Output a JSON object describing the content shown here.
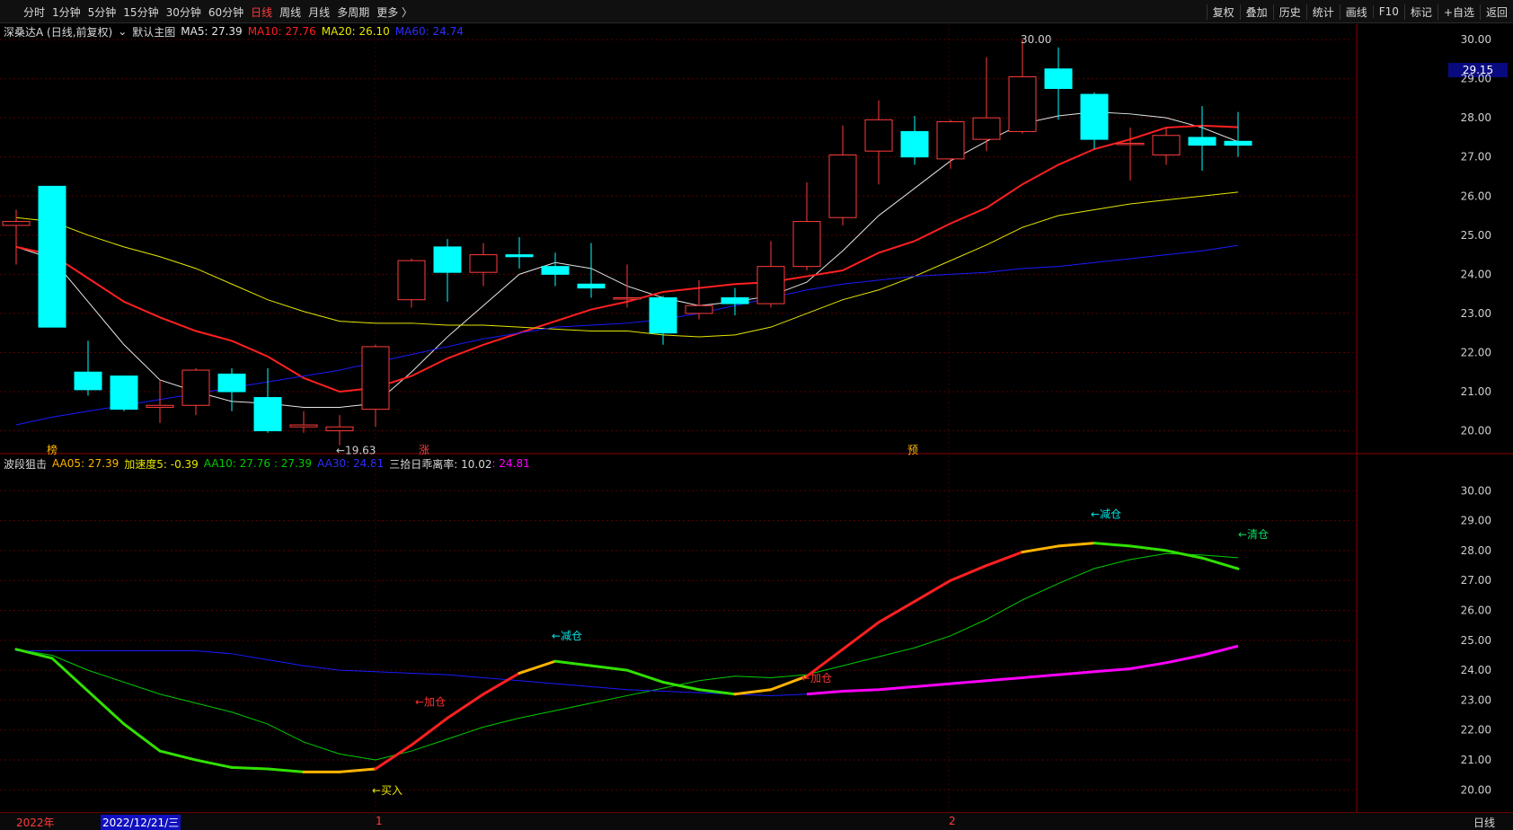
{
  "toolbar": {
    "periods": [
      "分时",
      "1分钟",
      "5分钟",
      "15分钟",
      "30分钟",
      "60分钟",
      "日线",
      "周线",
      "月线",
      "多周期",
      "更多 〉"
    ],
    "active_period": "日线",
    "tools": [
      "复权",
      "叠加",
      "历史",
      "统计",
      "画线",
      "F10",
      "标记",
      "+自选",
      "返回"
    ]
  },
  "main_legend": {
    "stock": "深桑达A (日线,前复权)",
    "template": "默认主图",
    "ma5": "MA5: 27.39",
    "ma10": "MA10: 27.76",
    "ma20": "MA20: 26.10",
    "ma60": "MA60: 24.74"
  },
  "sub_legend": {
    "name": "波段狙击",
    "aa05": "AA05: 27.39",
    "accel": "加速度5: -0.39",
    "aa10": "AA10: 27.76 : 27.39",
    "aa30": "AA30: 24.81",
    "deviation_label": "三拾日乖离率: 10.02",
    "deviation_value": ": 24.81"
  },
  "current_price": "29.15",
  "high_marker": "30.00",
  "low_marker": "←19.63",
  "event_markers": [
    "榜",
    "涨",
    "预"
  ],
  "signals": {
    "buy": "←买入",
    "add1": "←加仓",
    "reduce1": "←减仓",
    "add2": "←加仓",
    "reduce2": "←减仓",
    "clear": "←清仓"
  },
  "bottom_bar": {
    "year": "2022年",
    "date": "2022/12/21/三",
    "month1": "1",
    "month2": "2",
    "period": "日线"
  },
  "colors": {
    "up": "#ff3c3c",
    "down": "#00ffff",
    "ma5": "#e6e6e6",
    "ma10": "#ff2020",
    "ma20": "#e6e600",
    "ma60": "#1a1aff",
    "aa10": "#00cc00",
    "deviation": "#ff00ff"
  },
  "chart_data": [
    {
      "type": "candlestick",
      "title": "深桑达A (日线,前复权)",
      "ylim": [
        19.6,
        30.3
      ],
      "y_ticks": [
        20,
        21,
        22,
        23,
        24,
        25,
        26,
        27,
        28,
        29,
        30
      ],
      "candles": [
        {
          "o": 25.25,
          "h": 25.65,
          "l": 24.25,
          "c": 25.35
        },
        {
          "o": 26.25,
          "h": 26.25,
          "l": 22.65,
          "c": 22.65
        },
        {
          "o": 21.5,
          "h": 22.3,
          "l": 20.9,
          "c": 21.05
        },
        {
          "o": 21.4,
          "h": 21.4,
          "l": 20.5,
          "c": 20.55
        },
        {
          "o": 20.6,
          "h": 21.3,
          "l": 20.2,
          "c": 20.65
        },
        {
          "o": 20.65,
          "h": 21.6,
          "l": 20.4,
          "c": 21.55
        },
        {
          "o": 21.45,
          "h": 21.6,
          "l": 20.5,
          "c": 21.0
        },
        {
          "o": 20.85,
          "h": 21.6,
          "l": 19.95,
          "c": 20.0
        },
        {
          "o": 20.1,
          "h": 20.5,
          "l": 19.95,
          "c": 20.15
        },
        {
          "o": 20.0,
          "h": 20.4,
          "l": 19.63,
          "c": 20.1
        },
        {
          "o": 20.55,
          "h": 22.2,
          "l": 20.1,
          "c": 22.15
        },
        {
          "o": 23.35,
          "h": 24.4,
          "l": 23.15,
          "c": 24.35
        },
        {
          "o": 24.7,
          "h": 24.9,
          "l": 23.3,
          "c": 24.05
        },
        {
          "o": 24.05,
          "h": 24.8,
          "l": 23.7,
          "c": 24.5
        },
        {
          "o": 24.5,
          "h": 24.95,
          "l": 24.15,
          "c": 24.45
        },
        {
          "o": 24.2,
          "h": 24.55,
          "l": 23.7,
          "c": 24.0
        },
        {
          "o": 23.75,
          "h": 24.8,
          "l": 23.4,
          "c": 23.65
        },
        {
          "o": 23.4,
          "h": 24.25,
          "l": 23.15,
          "c": 23.4
        },
        {
          "o": 23.4,
          "h": 23.45,
          "l": 22.2,
          "c": 22.5
        },
        {
          "o": 23.0,
          "h": 23.85,
          "l": 22.85,
          "c": 23.2
        },
        {
          "o": 23.4,
          "h": 23.65,
          "l": 22.95,
          "c": 23.25
        },
        {
          "o": 23.25,
          "h": 24.85,
          "l": 23.15,
          "c": 24.2
        },
        {
          "o": 24.2,
          "h": 26.35,
          "l": 24.1,
          "c": 25.35
        },
        {
          "o": 25.45,
          "h": 27.8,
          "l": 25.25,
          "c": 27.05
        },
        {
          "o": 27.15,
          "h": 28.45,
          "l": 26.3,
          "c": 27.95
        },
        {
          "o": 27.65,
          "h": 28.05,
          "l": 26.8,
          "c": 27.0
        },
        {
          "o": 26.95,
          "h": 27.95,
          "l": 26.7,
          "c": 27.9
        },
        {
          "o": 27.45,
          "h": 29.55,
          "l": 27.15,
          "c": 28.0
        },
        {
          "o": 27.65,
          "h": 30.0,
          "l": 27.6,
          "c": 29.05
        },
        {
          "o": 29.25,
          "h": 29.8,
          "l": 27.95,
          "c": 28.75
        },
        {
          "o": 28.6,
          "h": 28.65,
          "l": 27.2,
          "c": 27.45
        },
        {
          "o": 27.35,
          "h": 27.75,
          "l": 26.4,
          "c": 27.35
        },
        {
          "o": 27.05,
          "h": 27.75,
          "l": 26.8,
          "c": 27.55
        },
        {
          "o": 27.5,
          "h": 28.3,
          "l": 26.65,
          "c": 27.3
        },
        {
          "o": 27.4,
          "h": 28.15,
          "l": 27.0,
          "c": 27.3
        }
      ],
      "series": [
        {
          "name": "MA5",
          "values": [
            24.7,
            24.4,
            23.3,
            22.2,
            21.3,
            21.0,
            20.75,
            20.7,
            20.6,
            20.6,
            20.7,
            21.5,
            22.4,
            23.2,
            24.0,
            24.3,
            24.15,
            23.7,
            23.4,
            23.2,
            23.3,
            23.45,
            23.8,
            24.6,
            25.5,
            26.2,
            26.9,
            27.4,
            27.85,
            28.05,
            28.15,
            28.1,
            28.0,
            27.75,
            27.39
          ]
        },
        {
          "name": "MA10",
          "values": [
            24.7,
            24.5,
            23.9,
            23.3,
            22.9,
            22.55,
            22.3,
            21.9,
            21.35,
            21.0,
            21.1,
            21.4,
            21.85,
            22.2,
            22.5,
            22.8,
            23.1,
            23.3,
            23.55,
            23.65,
            23.75,
            23.8,
            23.95,
            24.1,
            24.55,
            24.85,
            25.3,
            25.7,
            26.3,
            26.8,
            27.2,
            27.45,
            27.75,
            27.8,
            27.76
          ]
        },
        {
          "name": "MA20",
          "values": [
            25.45,
            25.35,
            25.0,
            24.7,
            24.45,
            24.15,
            23.75,
            23.35,
            23.05,
            22.8,
            22.75,
            22.75,
            22.7,
            22.7,
            22.65,
            22.6,
            22.55,
            22.55,
            22.45,
            22.4,
            22.45,
            22.65,
            23.0,
            23.35,
            23.6,
            23.95,
            24.35,
            24.75,
            25.2,
            25.5,
            25.65,
            25.8,
            25.9,
            26.0,
            26.1
          ]
        },
        {
          "name": "MA60",
          "values": [
            20.15,
            20.35,
            20.5,
            20.65,
            20.8,
            20.95,
            21.1,
            21.25,
            21.4,
            21.55,
            21.75,
            21.95,
            22.15,
            22.35,
            22.5,
            22.65,
            22.7,
            22.75,
            22.85,
            23.0,
            23.2,
            23.4,
            23.6,
            23.75,
            23.85,
            23.95,
            24.0,
            24.05,
            24.15,
            24.2,
            24.3,
            24.4,
            24.5,
            24.6,
            24.74
          ]
        }
      ]
    },
    {
      "type": "line",
      "title": "波段狙击",
      "ylim": [
        19.5,
        31.0
      ],
      "y_ticks": [
        20,
        21,
        22,
        23,
        24,
        25,
        26,
        27,
        28,
        29,
        30
      ],
      "series": [
        {
          "name": "AA05",
          "values": [
            24.7,
            24.4,
            23.3,
            22.2,
            21.3,
            21.0,
            20.75,
            20.7,
            20.6,
            20.6,
            20.7,
            21.5,
            22.4,
            23.2,
            23.9,
            24.3,
            24.15,
            24.0,
            23.6,
            23.35,
            23.2,
            23.35,
            23.8,
            24.7,
            25.6,
            26.3,
            27.0,
            27.5,
            27.95,
            28.15,
            28.25,
            28.15,
            28.0,
            27.75,
            27.39
          ]
        },
        {
          "name": "AA10",
          "values": [
            24.7,
            24.5,
            24.0,
            23.6,
            23.2,
            22.9,
            22.6,
            22.2,
            21.6,
            21.2,
            21.0,
            21.3,
            21.7,
            22.1,
            22.4,
            22.65,
            22.9,
            23.15,
            23.4,
            23.65,
            23.8,
            23.75,
            23.85,
            24.15,
            24.45,
            24.75,
            25.15,
            25.7,
            26.35,
            26.9,
            27.4,
            27.7,
            27.9,
            27.85,
            27.76
          ]
        },
        {
          "name": "AA30",
          "values": [
            24.65,
            24.65,
            24.65,
            24.65,
            24.65,
            24.65,
            24.55,
            24.35,
            24.15,
            24.0,
            23.95,
            23.9,
            23.85,
            23.75,
            23.65,
            23.55,
            23.45,
            23.35,
            23.3,
            23.25,
            23.2,
            23.15,
            23.2,
            23.3,
            23.35,
            23.45,
            23.55,
            23.65,
            23.75,
            23.85,
            23.95,
            24.05,
            24.25,
            24.5,
            24.81
          ]
        }
      ]
    }
  ]
}
